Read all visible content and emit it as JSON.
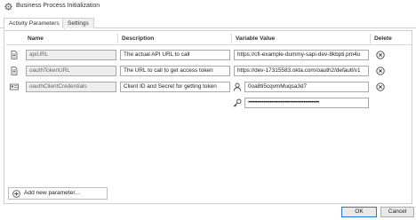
{
  "window": {
    "title": "Business Process Initialization"
  },
  "tabs": [
    {
      "label": "Activity Parameters",
      "active": true
    },
    {
      "label": "Settings",
      "active": false
    }
  ],
  "table": {
    "columns": [
      "Name",
      "Description",
      "Variable Value",
      "Delete"
    ],
    "rows": [
      {
        "icon": "document-icon",
        "name": "apiURL",
        "description": "The actual API URL to call",
        "value": "https://cfi-example-dummy-sapi-dev-8kbpti.pm4u"
      },
      {
        "icon": "document-icon",
        "name": "oauthTokenURL",
        "description": "The URL to call to get access token",
        "value": "https://dev-17315583.okta.com/oauth2/default/v1"
      },
      {
        "icon": "credentials-icon",
        "name": "oauthClientCredentials",
        "description": "Client ID and Secret for getting token",
        "value": "0oa8ti5cqvmMuqsa3d7",
        "secret": "••••••••••••••••••••••••••••••••••••••••••••••"
      }
    ]
  },
  "add_button": {
    "label": "Add new parameter..."
  },
  "footer": {
    "ok_label": "OK",
    "cancel_label": "Cancel"
  },
  "colors": {
    "accent": "#2b79d6",
    "readonly_bg": "#eeeeee",
    "border": "#a9a9a9"
  }
}
